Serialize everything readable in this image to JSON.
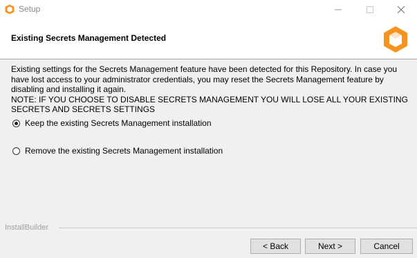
{
  "window": {
    "title": "Setup",
    "controls": [
      "minimize-icon",
      "maximize-icon",
      "close-icon"
    ]
  },
  "header": {
    "title": "Existing Secrets Management Detected",
    "logo_icon": "orange-box-logo-icon",
    "accent_color": "#f7941d"
  },
  "content": {
    "description": "Existing settings for the Secrets Management feature have been detected for this Repository. In case you have lost access to your administrator credentials, you may reset the Secrets Management feature by disabling and installing it again.",
    "note": "NOTE: IF YOU CHOOSE TO DISABLE SECRETS MANAGEMENT YOU WILL LOSE ALL YOUR EXISTING SECRETS AND SECRETS SETTINGS",
    "options": [
      {
        "label": "Keep the existing Secrets Management installation",
        "selected": true
      },
      {
        "label": "Remove the existing Secrets Management installation",
        "selected": false
      }
    ]
  },
  "footer": {
    "brand": "InstallBuilder",
    "back_label": "< Back",
    "next_label": "Next >",
    "cancel_label": "Cancel"
  }
}
